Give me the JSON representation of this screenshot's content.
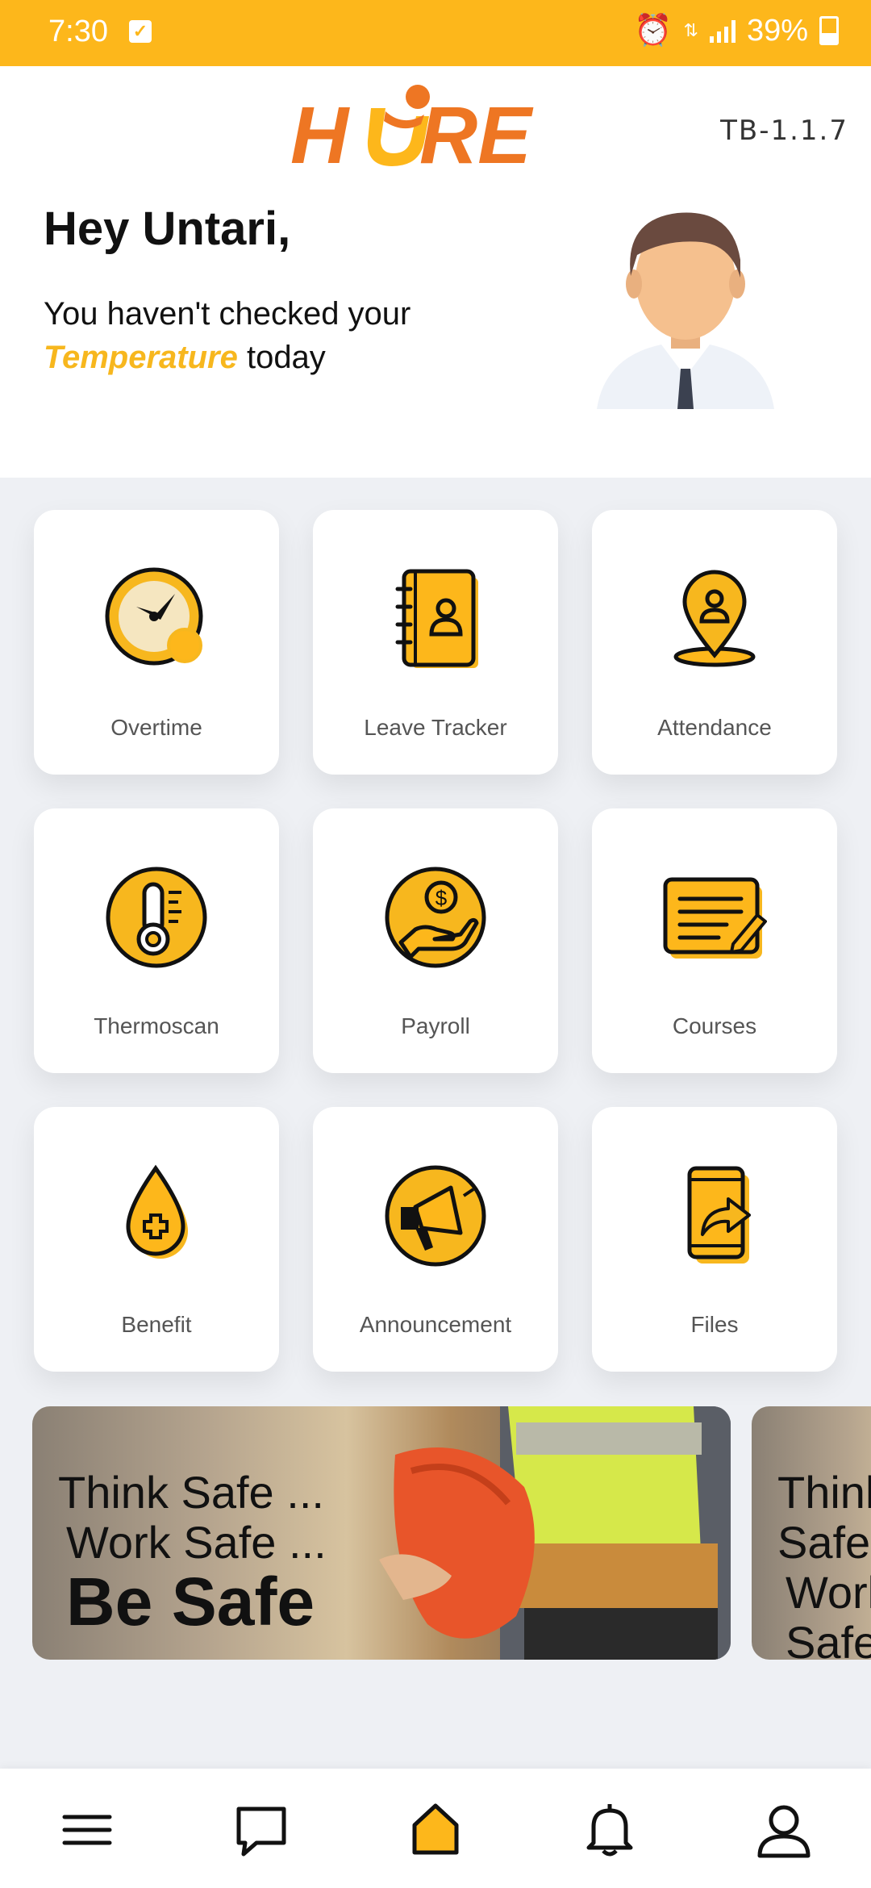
{
  "status_bar": {
    "time": "7:30",
    "battery": "39%"
  },
  "header": {
    "app_name": "HURE",
    "version": "TB-1.1.7",
    "greeting": "Hey Untari,",
    "message_prefix": "You haven't checked your",
    "message_highlight": "Temperature",
    "message_suffix": "today"
  },
  "menu": [
    {
      "label": "Overtime",
      "icon": "clock-icon"
    },
    {
      "label": "Leave Tracker",
      "icon": "notebook-icon"
    },
    {
      "label": "Attendance",
      "icon": "location-pin-icon"
    },
    {
      "label": "Thermoscan",
      "icon": "thermometer-icon"
    },
    {
      "label": "Payroll",
      "icon": "hand-coin-icon"
    },
    {
      "label": "Courses",
      "icon": "document-edit-icon"
    },
    {
      "label": "Benefit",
      "icon": "drop-plus-icon"
    },
    {
      "label": "Announcement",
      "icon": "megaphone-icon"
    },
    {
      "label": "Files",
      "icon": "phone-share-icon"
    }
  ],
  "banner": {
    "line1": "Think Safe ...",
    "line2": "Work Safe ...",
    "line3": "Be Safe"
  },
  "bottom_nav": [
    "menu-icon",
    "chat-icon",
    "home-icon",
    "bell-icon",
    "profile-icon"
  ],
  "colors": {
    "accent": "#FDB71B",
    "brand_orange": "#EE7623"
  }
}
